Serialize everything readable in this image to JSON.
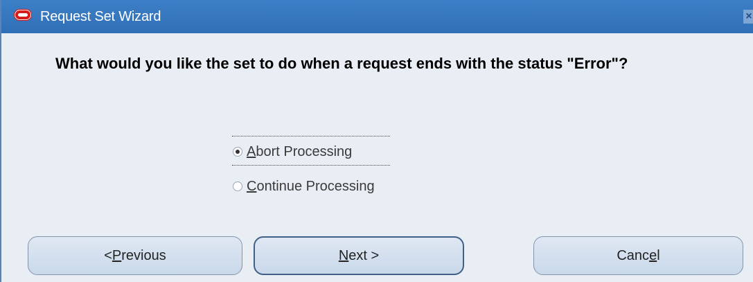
{
  "window": {
    "title": "Request Set Wizard",
    "close_glyph": "×",
    "icon": "oracle-logo-icon"
  },
  "question": {
    "text": "What would you like the set to do when a request ends with the status \"Error\"?"
  },
  "options": [
    {
      "pre": "",
      "mnemonic": "A",
      "post": "bort Processing",
      "selected": true
    },
    {
      "pre": "",
      "mnemonic": "C",
      "post": "ontinue Processing",
      "selected": false
    }
  ],
  "buttons": {
    "previous": {
      "pre": "< ",
      "mnemonic": "P",
      "post": "revious"
    },
    "next": {
      "pre": "",
      "mnemonic": "N",
      "post": "ext >"
    },
    "cancel": {
      "pre": "Canc",
      "mnemonic": "e",
      "post": "l"
    }
  },
  "colors": {
    "titlebar": "#2f6fb6",
    "background": "#e9eef5",
    "button_fill": "#d3dfee"
  }
}
